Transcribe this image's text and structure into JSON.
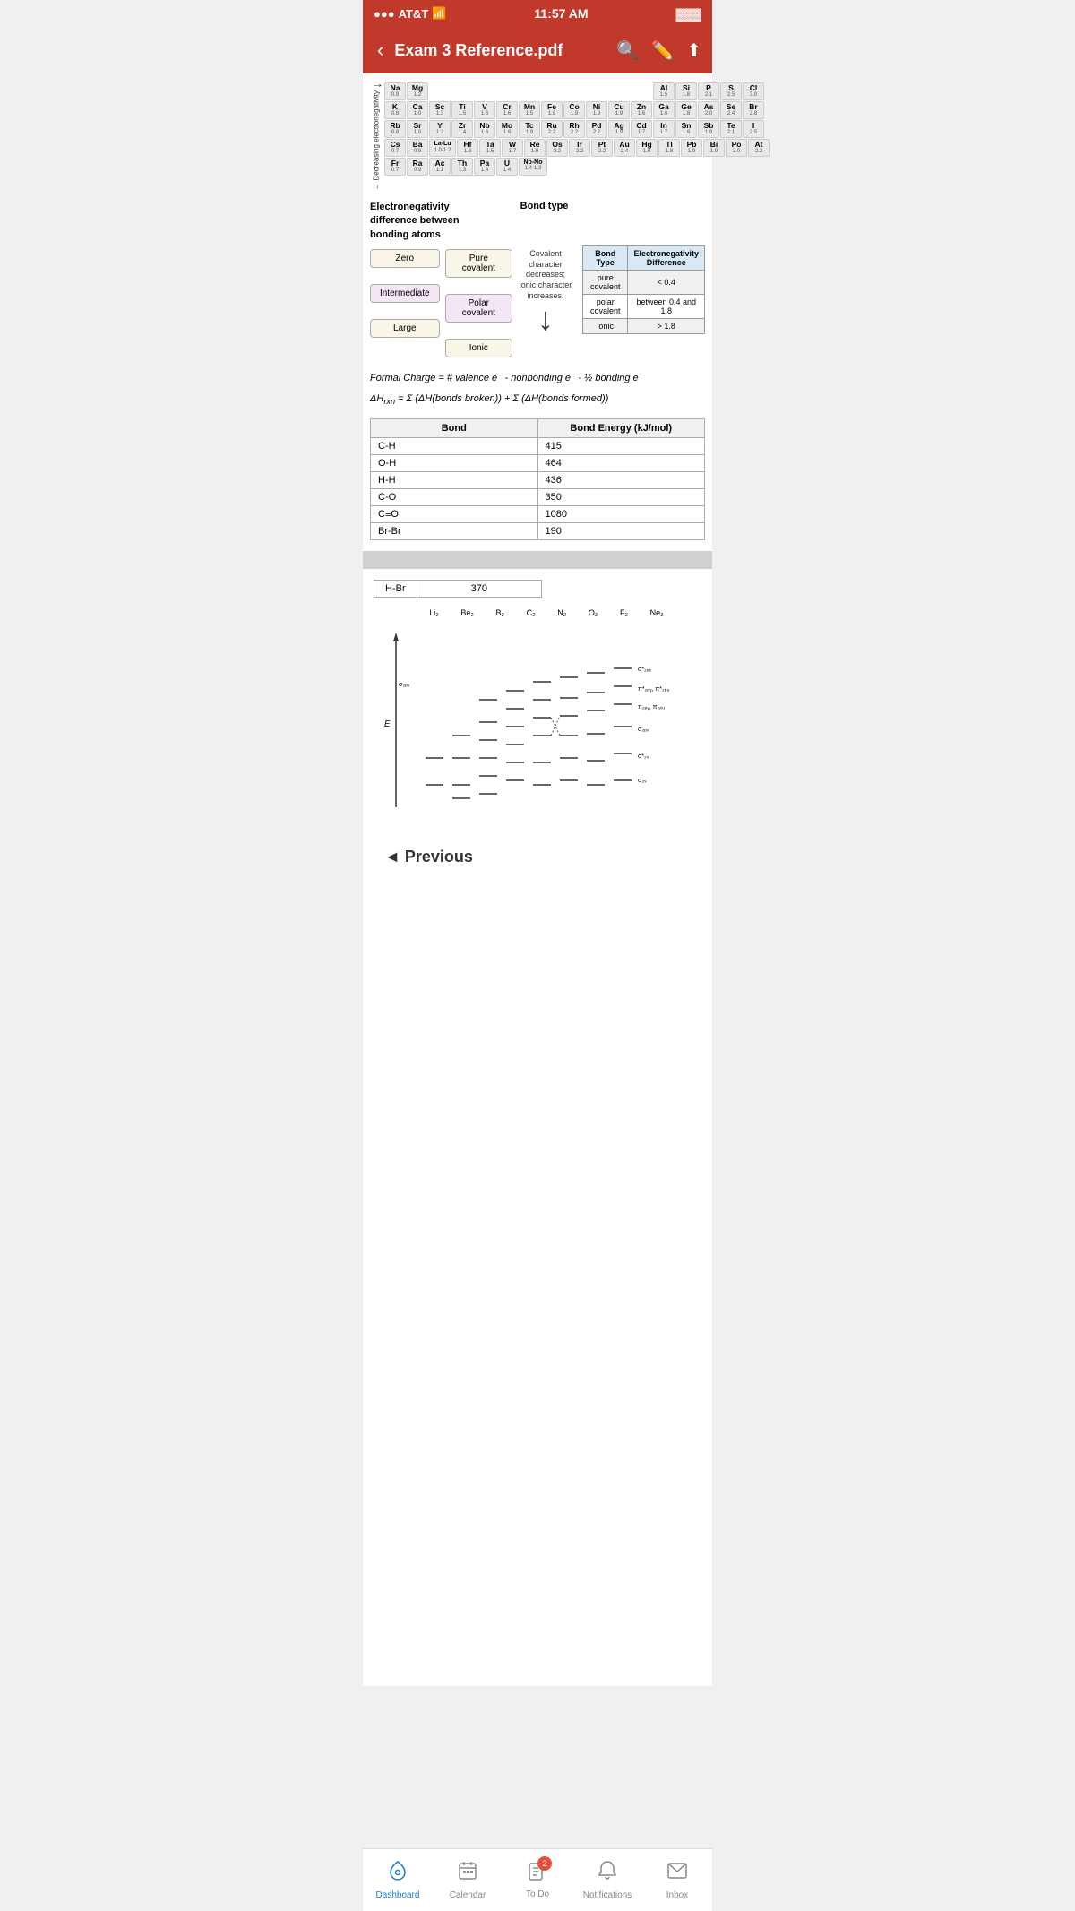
{
  "statusBar": {
    "carrier": "AT&T",
    "time": "11:57 AM",
    "battery": "🔋"
  },
  "navBar": {
    "title": "Exam 3 Reference.pdf",
    "backLabel": "‹",
    "searchIcon": "🔍",
    "editIcon": "✏️",
    "shareIcon": "⬆️"
  },
  "periodicTable": {
    "rows": [
      [
        {
          "sym": "Na",
          "num": "0.9"
        },
        {
          "sym": "Mg",
          "num": "1.2"
        },
        {
          "spacer": true,
          "count": 10
        },
        {
          "sym": "Al",
          "num": "1.5"
        },
        {
          "sym": "Si",
          "num": "1.8"
        },
        {
          "sym": "P",
          "num": "2.1"
        },
        {
          "sym": "S",
          "num": "2.5"
        },
        {
          "sym": "Cl",
          "num": "3.0"
        }
      ],
      [
        {
          "sym": "K",
          "num": "0.8"
        },
        {
          "sym": "Ca",
          "num": "1.0"
        },
        {
          "sym": "Sc",
          "num": "1.3"
        },
        {
          "sym": "Ti",
          "num": "1.5"
        },
        {
          "sym": "V",
          "num": "1.6"
        },
        {
          "sym": "Cr",
          "num": "1.6"
        },
        {
          "sym": "Mn",
          "num": "1.5"
        },
        {
          "sym": "Fe",
          "num": "1.8"
        },
        {
          "sym": "Co",
          "num": "1.9"
        },
        {
          "sym": "Ni",
          "num": "1.9"
        },
        {
          "sym": "Cu",
          "num": "1.9"
        },
        {
          "sym": "Zn",
          "num": "1.6"
        },
        {
          "sym": "Ga",
          "num": "1.6"
        },
        {
          "sym": "Ge",
          "num": "1.8"
        },
        {
          "sym": "As",
          "num": "2.0"
        },
        {
          "sym": "Se",
          "num": "2.4"
        },
        {
          "sym": "Br",
          "num": "2.8"
        }
      ],
      [
        {
          "sym": "Rb",
          "num": "0.8"
        },
        {
          "sym": "Sr",
          "num": "1.0"
        },
        {
          "sym": "Y",
          "num": "1.2"
        },
        {
          "sym": "Zr",
          "num": "1.4"
        },
        {
          "sym": "Nb",
          "num": "1.6"
        },
        {
          "sym": "Mo",
          "num": "1.8"
        },
        {
          "sym": "Tc",
          "num": "1.9"
        },
        {
          "sym": "Ru",
          "num": "2.2"
        },
        {
          "sym": "Rh",
          "num": "2.2"
        },
        {
          "sym": "Pd",
          "num": "2.2"
        },
        {
          "sym": "Ag",
          "num": "1.9"
        },
        {
          "sym": "Cd",
          "num": "1.7"
        },
        {
          "sym": "In",
          "num": "1.7"
        },
        {
          "sym": "Sn",
          "num": "1.8"
        },
        {
          "sym": "Sb",
          "num": "1.9"
        },
        {
          "sym": "Te",
          "num": "2.1"
        },
        {
          "sym": "I",
          "num": "2.5"
        }
      ],
      [
        {
          "sym": "Cs",
          "num": "0.7"
        },
        {
          "sym": "Ba",
          "num": "0.9"
        },
        {
          "sym": "La-Lu",
          "num": "1.0-1.2"
        },
        {
          "sym": "Hf",
          "num": "1.3"
        },
        {
          "sym": "Ta",
          "num": "1.5"
        },
        {
          "sym": "W",
          "num": "1.7"
        },
        {
          "sym": "Re",
          "num": "1.9"
        },
        {
          "sym": "Os",
          "num": "2.2"
        },
        {
          "sym": "Ir",
          "num": "2.2"
        },
        {
          "sym": "Pt",
          "num": "2.2"
        },
        {
          "sym": "Au",
          "num": "2.4"
        },
        {
          "sym": "Hg",
          "num": "1.9"
        },
        {
          "sym": "Tl",
          "num": "1.8"
        },
        {
          "sym": "Pb",
          "num": "1.9"
        },
        {
          "sym": "Bi",
          "num": "1.9"
        },
        {
          "sym": "Po",
          "num": "2.0"
        },
        {
          "sym": "At",
          "num": "2.2"
        }
      ],
      [
        {
          "sym": "Fr",
          "num": "0.7"
        },
        {
          "sym": "Ra",
          "num": "0.9"
        },
        {
          "sym": "Ac",
          "num": "1.1"
        },
        {
          "sym": "Th",
          "num": "1.3"
        },
        {
          "sym": "Pa",
          "num": "1.4"
        },
        {
          "sym": "U",
          "num": "1.4"
        },
        {
          "sym": "Np-No",
          "num": "1.4-1.3"
        }
      ]
    ]
  },
  "electronegativity": {
    "sectionTitle": "Electronegativity\ndifference between\nbonding atoms",
    "bondTypeLabel": "Bond type",
    "leftColumn": [
      "Zero",
      "Intermediate",
      "Large"
    ],
    "rightColumn": [
      "Pure covalent",
      "Polar covalent",
      "Ionic"
    ],
    "arrowText": "Covalent character decreases; ionic character increases.",
    "tableHeaders": [
      "Bond Type",
      "Electronegativity Difference"
    ],
    "tableRows": [
      [
        "pure covalent",
        "< 0.4"
      ],
      [
        "polar covalent",
        "between 0.4 and 1.8"
      ],
      [
        "ionic",
        "> 1.8"
      ]
    ]
  },
  "formulas": {
    "formalCharge": "Formal Charge = # valence e⁻ - nonbonding e⁻ - ½ bonding e⁻",
    "deltaH": "ΔHrxn = Σ (ΔH(bonds broken)) + Σ (ΔH(bonds formed))"
  },
  "bondEnergyTable": {
    "headers": [
      "Bond",
      "Bond Energy (kJ/mol)"
    ],
    "rows": [
      [
        "C-H",
        "415"
      ],
      [
        "O-H",
        "464"
      ],
      [
        "H-H",
        "436"
      ],
      [
        "C-O",
        "350"
      ],
      [
        "C≡O",
        "1080"
      ],
      [
        "Br-Br",
        "190"
      ]
    ]
  },
  "hbrRow": {
    "label": "H-Br",
    "value": "370"
  },
  "moDiagram": {
    "molecules": [
      "Li₂",
      "Be₂",
      "B₂",
      "C₂",
      "N₂",
      "O₂",
      "F₂",
      "Ne₂"
    ],
    "leftLabel": "σ₂ₚₓ",
    "rightLabels": [
      "σ*₂ₚₓ",
      "π*₂ₚᵧ, π*₂ₚᵤ",
      "π₂ₚᵧ, π₂ₚᵤ",
      "σ₂ₚₓ",
      "σ*₂ₛ",
      "σ₂ₛ"
    ],
    "energyLabel": "E"
  },
  "navigation": {
    "previousLabel": "◄ Previous"
  },
  "bottomNav": {
    "items": [
      {
        "label": "Dashboard",
        "icon": "dashboard",
        "active": true
      },
      {
        "label": "Calendar",
        "icon": "calendar",
        "active": false
      },
      {
        "label": "To Do",
        "icon": "todo",
        "active": false,
        "badge": "2"
      },
      {
        "label": "Notifications",
        "icon": "bell",
        "active": false
      },
      {
        "label": "Inbox",
        "icon": "inbox",
        "active": false
      }
    ]
  }
}
